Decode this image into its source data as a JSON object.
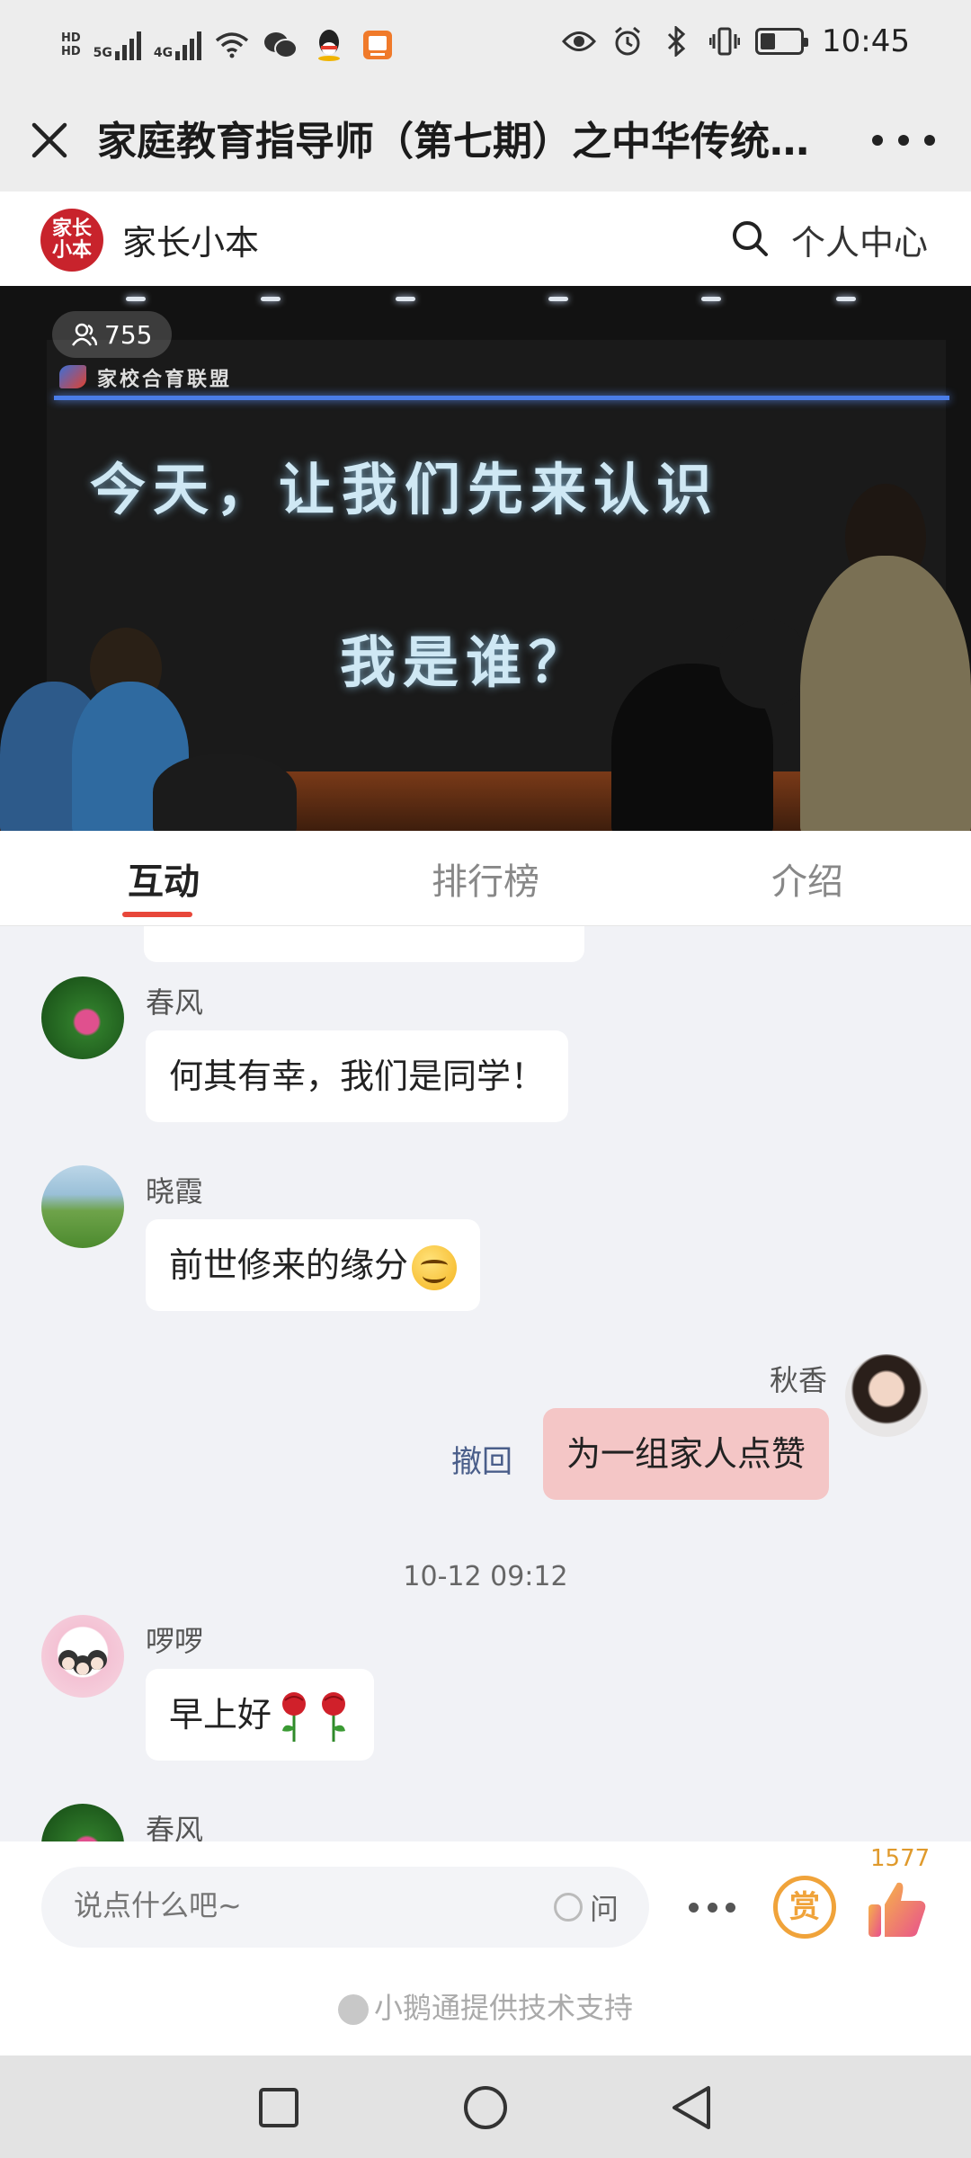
{
  "status_bar": {
    "hd1": "HD",
    "hd2": "HD",
    "net1": "5G",
    "net2": "4G",
    "time": "10:45",
    "icons": [
      "hd-icon",
      "signal-5g-icon",
      "signal-4g-icon",
      "wifi-icon",
      "wechat-icon",
      "qq-icon",
      "app-notification-icon",
      "eye-icon",
      "alarm-icon",
      "bluetooth-icon",
      "vibrate-icon",
      "battery-icon"
    ]
  },
  "title_bar": {
    "title": "家庭教育指导师（第七期）之中华传统…",
    "close_icon": "close-icon",
    "more_icon": "more-icon"
  },
  "header": {
    "logo_text_1": "家长",
    "logo_text_2": "小本",
    "brand": "家长小本",
    "profile": "个人中心"
  },
  "video": {
    "viewers": "755",
    "school": "家校合育联盟",
    "line1": "今天，让我们先来认识",
    "line2": "我是谁？"
  },
  "tabs": [
    {
      "label": "互动",
      "active": true
    },
    {
      "label": "排行榜",
      "active": false
    },
    {
      "label": "介绍",
      "active": false
    }
  ],
  "messages": [
    {
      "sender": "春风",
      "text": "何其有幸，我们是同学！",
      "side": "left"
    },
    {
      "sender": "晓霞",
      "text": "前世修来的缘分",
      "emoji": "smile-emoji",
      "side": "left"
    },
    {
      "sender": "秋香",
      "text": "为一组家人点赞",
      "side": "right",
      "recall": "撤回"
    },
    {
      "timestamp": "10-12 09:12"
    },
    {
      "sender": "啰啰",
      "text": "早上好",
      "emoji": "rose-emoji",
      "side": "left"
    },
    {
      "sender": "春风",
      "side": "left"
    }
  ],
  "bottom": {
    "input_placeholder": "说点什么吧~",
    "ask": "问",
    "reward": "赏",
    "like_count": "1577",
    "powered_by": "小鹅通提供技术支持"
  },
  "colors": {
    "accent": "#e8473a",
    "brand_red": "#c8232c",
    "my_bubble": "#f4c6c6",
    "reward": "#f0a33a"
  }
}
